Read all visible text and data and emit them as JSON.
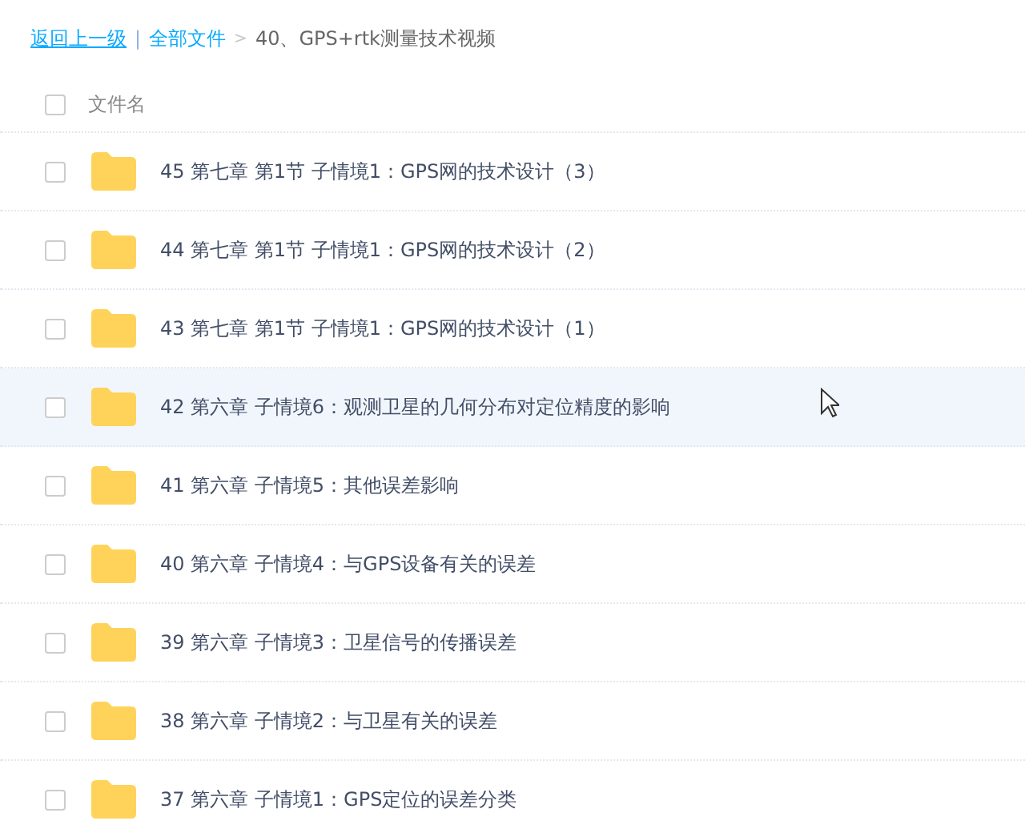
{
  "breadcrumb": {
    "back": "返回上一级",
    "separator": "|",
    "root": "全部文件",
    "arrow": ">",
    "current": "40、GPS+rtk测量技术视频"
  },
  "header": {
    "checked": false,
    "label": "文件名"
  },
  "files": [
    {
      "name": "45 第七章 第1节 子情境1：GPS网的技术设计（3）",
      "checked": false,
      "highlighted": false
    },
    {
      "name": "44 第七章 第1节 子情境1：GPS网的技术设计（2）",
      "checked": false,
      "highlighted": false
    },
    {
      "name": "43 第七章 第1节 子情境1：GPS网的技术设计（1）",
      "checked": false,
      "highlighted": false
    },
    {
      "name": "42 第六章 子情境6：观测卫星的几何分布对定位精度的影响",
      "checked": false,
      "highlighted": true
    },
    {
      "name": "41 第六章 子情境5：其他误差影响",
      "checked": false,
      "highlighted": false
    },
    {
      "name": "40 第六章 子情境4：与GPS设备有关的误差",
      "checked": false,
      "highlighted": false
    },
    {
      "name": "39 第六章 子情境3：卫星信号的传播误差",
      "checked": false,
      "highlighted": false
    },
    {
      "name": "38 第六章 子情境2：与卫星有关的误差",
      "checked": false,
      "highlighted": false
    },
    {
      "name": "37 第六章 子情境1：GPS定位的误差分类",
      "checked": false,
      "highlighted": false
    }
  ]
}
